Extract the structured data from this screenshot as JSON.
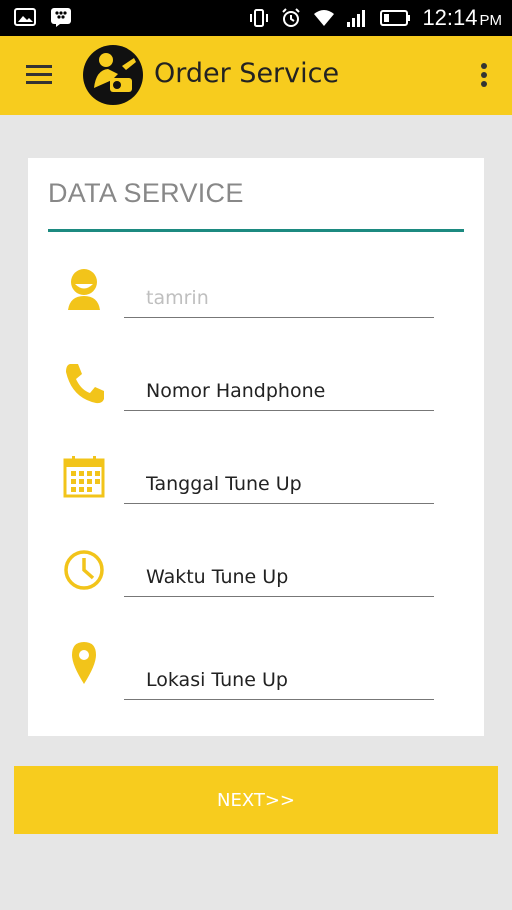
{
  "status_bar": {
    "time": "12:14",
    "ampm": "PM"
  },
  "app_bar": {
    "title": "Order Service"
  },
  "form": {
    "section_title": "DATA SERVICE",
    "fields": [
      {
        "icon": "person-icon",
        "value": "",
        "placeholder": "tamrin"
      },
      {
        "icon": "phone-icon",
        "value": "",
        "placeholder": "Nomor Handphone"
      },
      {
        "icon": "calendar-icon",
        "value": "",
        "placeholder": "Tanggal Tune Up"
      },
      {
        "icon": "clock-icon",
        "value": "",
        "placeholder": "Waktu Tune Up"
      },
      {
        "icon": "location-pin-icon",
        "value": "",
        "placeholder": "Lokasi Tune Up"
      }
    ]
  },
  "next_button": {
    "label": "NEXT>>"
  },
  "colors": {
    "accent": "#f7cc1e",
    "divider": "#1c8a80",
    "icon": "#f2c41a",
    "background": "#e6e6e6"
  }
}
